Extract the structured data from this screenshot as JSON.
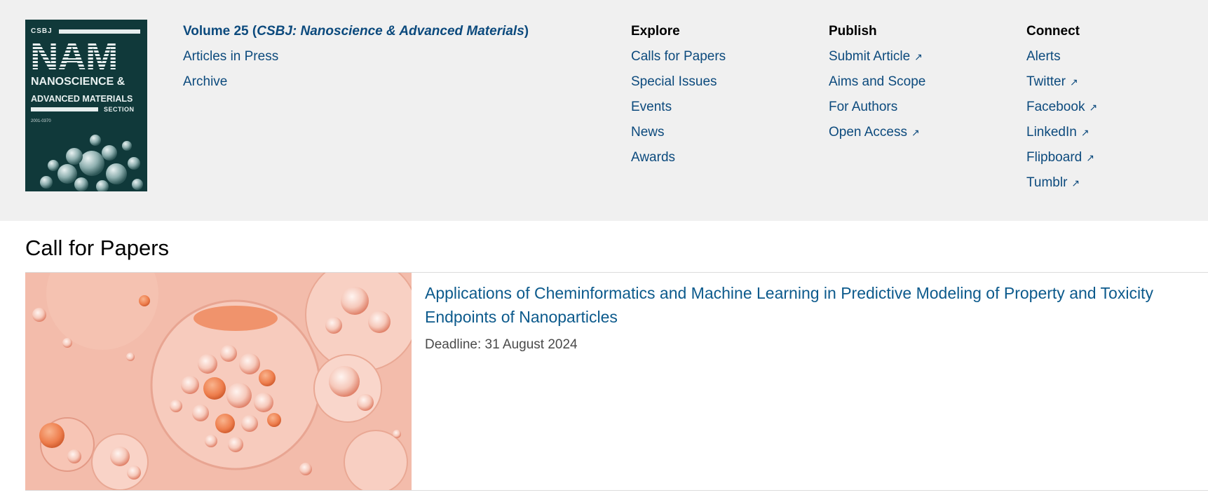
{
  "cover": {
    "top_label": "CSBJ",
    "big_title": "NAM",
    "subtitle_line1": "NANOSCIENCE &",
    "subtitle_line2": "ADVANCED MATERIALS",
    "section_label": "SECTION",
    "issn": "2001-0370"
  },
  "journal": {
    "volume_prefix": "Volume 25 (",
    "volume_journal": "CSBJ: Nanoscience & Advanced Materials",
    "volume_suffix": ")",
    "links": [
      "Articles in Press",
      "Archive"
    ]
  },
  "explore": {
    "heading": "Explore",
    "items": [
      "Calls for Papers",
      "Special Issues",
      "Events",
      "News",
      "Awards"
    ]
  },
  "publish": {
    "heading": "Publish",
    "items": [
      {
        "label": "Submit Article",
        "external": "↗"
      },
      {
        "label": "Aims and Scope",
        "external": ""
      },
      {
        "label": "For Authors",
        "external": ""
      },
      {
        "label": "Open Access",
        "external": "↗"
      }
    ]
  },
  "connect": {
    "heading": "Connect",
    "items": [
      {
        "label": "Alerts",
        "external": ""
      },
      {
        "label": "Twitter",
        "external": "↗"
      },
      {
        "label": "Facebook",
        "external": "↗"
      },
      {
        "label": "LinkedIn",
        "external": "↗"
      },
      {
        "label": "Flipboard",
        "external": "↗"
      },
      {
        "label": "Tumblr",
        "external": "↗"
      }
    ]
  },
  "call_for_papers": {
    "heading": "Call for Papers",
    "card": {
      "title": "Applications of Cheminformatics and Machine Learning in Predictive Modeling of Property and Toxicity Endpoints of Nanoparticles",
      "deadline": "Deadline: 31 August 2024",
      "image_icon": "bubbles-image"
    }
  },
  "colors": {
    "link": "#0c4a7d",
    "header_bg": "#f0f0f0",
    "cover_bg": "#10393a",
    "card_title": "#0c5a8c"
  }
}
